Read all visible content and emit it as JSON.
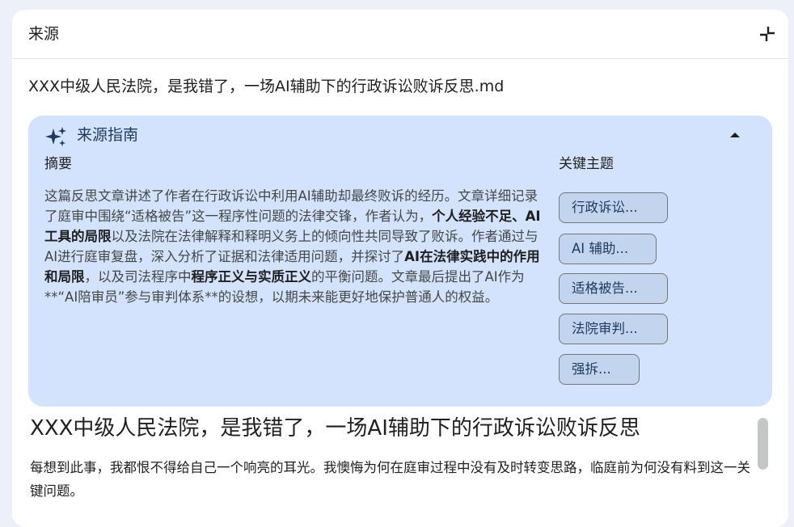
{
  "panel": {
    "title": "来源",
    "collapse_icon": "collapse-content-icon"
  },
  "file": {
    "name": "XXX中级人民法院，是我错了，一场AI辅助下的行政诉讼败诉反思.md"
  },
  "guide": {
    "title": "来源指南",
    "icon": "sparkle-icon",
    "toggle_icon": "triangle-up-icon",
    "summary_label": "摘要",
    "summary_parts": [
      {
        "text": "这篇反思文章讲述了作者在行政诉讼中利用AI辅助却最终败诉的经历。文章详细记录了庭审中围绕“适格被告”这一程序性问题的法律交锋，作者认为，",
        "bold": false
      },
      {
        "text": "个人经验不足、AI工具的局限",
        "bold": true
      },
      {
        "text": "以及法院在法律解释和释明义务上的倾向性共同导致了败诉。作者通过与AI进行庭审复盘，深入分析了证据和法律适用问题，并探讨了",
        "bold": false
      },
      {
        "text": "AI在法律实践中的作用和局限",
        "bold": true
      },
      {
        "text": "，以及司法程序中",
        "bold": false
      },
      {
        "text": "程序正义与实质正义",
        "bold": true
      },
      {
        "text": "的平衡问题。文章最后提出了AI作为**“AI陪审员”参与审判体系**的设想，以期未来能更好地保护普通人的权益。",
        "bold": false
      }
    ],
    "topics_label": "关键主题",
    "topics": [
      "行政诉讼...",
      "AI 辅助...",
      "适格被告...",
      "法院审判...",
      "强拆..."
    ]
  },
  "document": {
    "heading": "XXX中级人民法院，是我错了，一场AI辅助下的行政诉讼败诉反思",
    "paragraph": "每想到此事，我都恨不得给自己一个响亮的耳光。我懊悔为何在庭审过程中没有及时转变思路，临庭前为何没有料到这一关键问题。"
  },
  "colors": {
    "page_background": "#edf0f9",
    "card_background": "#d3e3fd",
    "chip_background": "#c3d4ef",
    "accent": "#1f3a5f"
  }
}
